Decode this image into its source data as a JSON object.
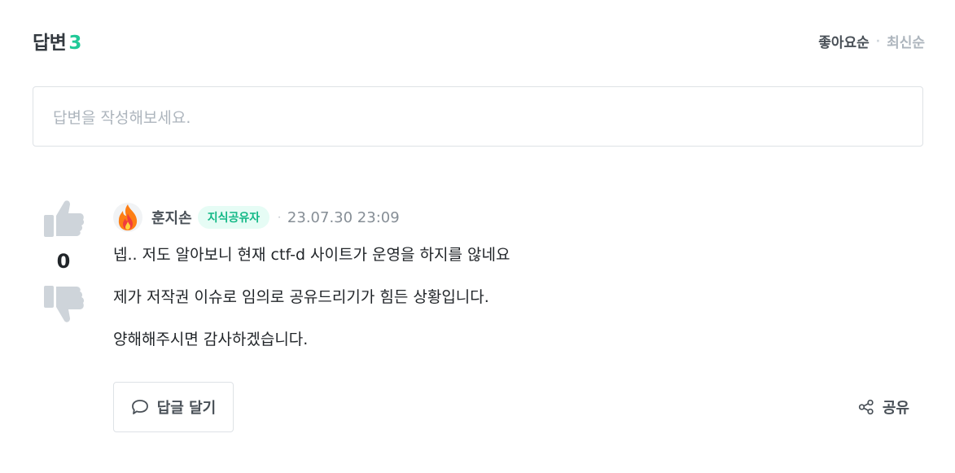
{
  "header": {
    "title": "답변",
    "count": "3",
    "sort_options": [
      "좋아요순",
      "최신순"
    ],
    "sort_separator": "·",
    "active_sort": "좋아요순",
    "accent_color": "#20c997"
  },
  "answer_input": {
    "placeholder": "답변을 작성해보세요."
  },
  "answer": {
    "votes": {
      "count": "0",
      "upvote_icon": "thumbs-up-icon",
      "downvote_icon": "thumbs-down-icon"
    },
    "author": {
      "avatar_icon": "fire-icon",
      "name": "훈지손",
      "badge": "지식공유자",
      "separator": "·",
      "timestamp": "23.07.30 23:09"
    },
    "paragraphs": [
      "넵.. 저도 알아보니 현재 ctf-d 사이트가 운영을 하지를 않네요",
      "제가 저작권 이슈로 임의로 공유드리기가 힘든 상황입니다.",
      "양해해주시면 감사하겠습니다."
    ],
    "actions": {
      "reply_label": "답글 달기",
      "reply_icon": "speech-bubble-icon",
      "share_label": "공유",
      "share_icon": "share-icon"
    }
  }
}
